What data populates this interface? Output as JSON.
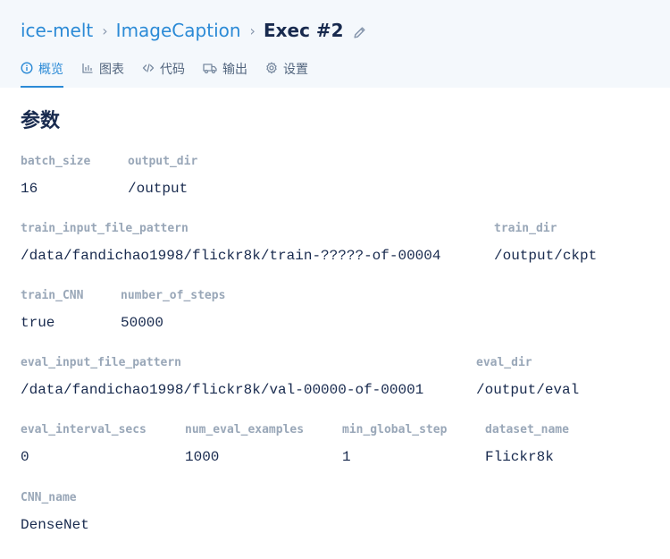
{
  "breadcrumb": {
    "project": "ice-melt",
    "separator": "›",
    "repo": "ImageCaption",
    "current": "Exec #2"
  },
  "tabs": [
    {
      "label": "概览",
      "icon": "info-icon",
      "active": true
    },
    {
      "label": "图表",
      "icon": "bar-chart-icon",
      "active": false
    },
    {
      "label": "代码",
      "icon": "code-icon",
      "active": false
    },
    {
      "label": "输出",
      "icon": "truck-icon",
      "active": false
    },
    {
      "label": "设置",
      "icon": "gear-icon",
      "active": false
    }
  ],
  "section_title": "参数",
  "params": [
    {
      "key": "batch_size",
      "value": "16"
    },
    {
      "key": "output_dir",
      "value": "/output"
    },
    {
      "key": "train_input_file_pattern",
      "value": "/data/fandichao1998/flickr8k/train-?????-of-00004"
    },
    {
      "key": "train_dir",
      "value": "/output/ckpt"
    },
    {
      "key": "train_CNN",
      "value": "true"
    },
    {
      "key": "number_of_steps",
      "value": "50000"
    },
    {
      "key": "eval_input_file_pattern",
      "value": "/data/fandichao1998/flickr8k/val-00000-of-00001"
    },
    {
      "key": "eval_dir",
      "value": "/output/eval"
    },
    {
      "key": "eval_interval_secs",
      "value": "0"
    },
    {
      "key": "num_eval_examples",
      "value": "1000"
    },
    {
      "key": "min_global_step",
      "value": "1"
    },
    {
      "key": "dataset_name",
      "value": "Flickr8k"
    },
    {
      "key": "CNN_name",
      "value": "DenseNet"
    }
  ],
  "colors": {
    "accent": "#2b8ad6",
    "header_bg": "#f4f8fc",
    "text": "#182a4e",
    "key_text": "#99a7b8"
  }
}
